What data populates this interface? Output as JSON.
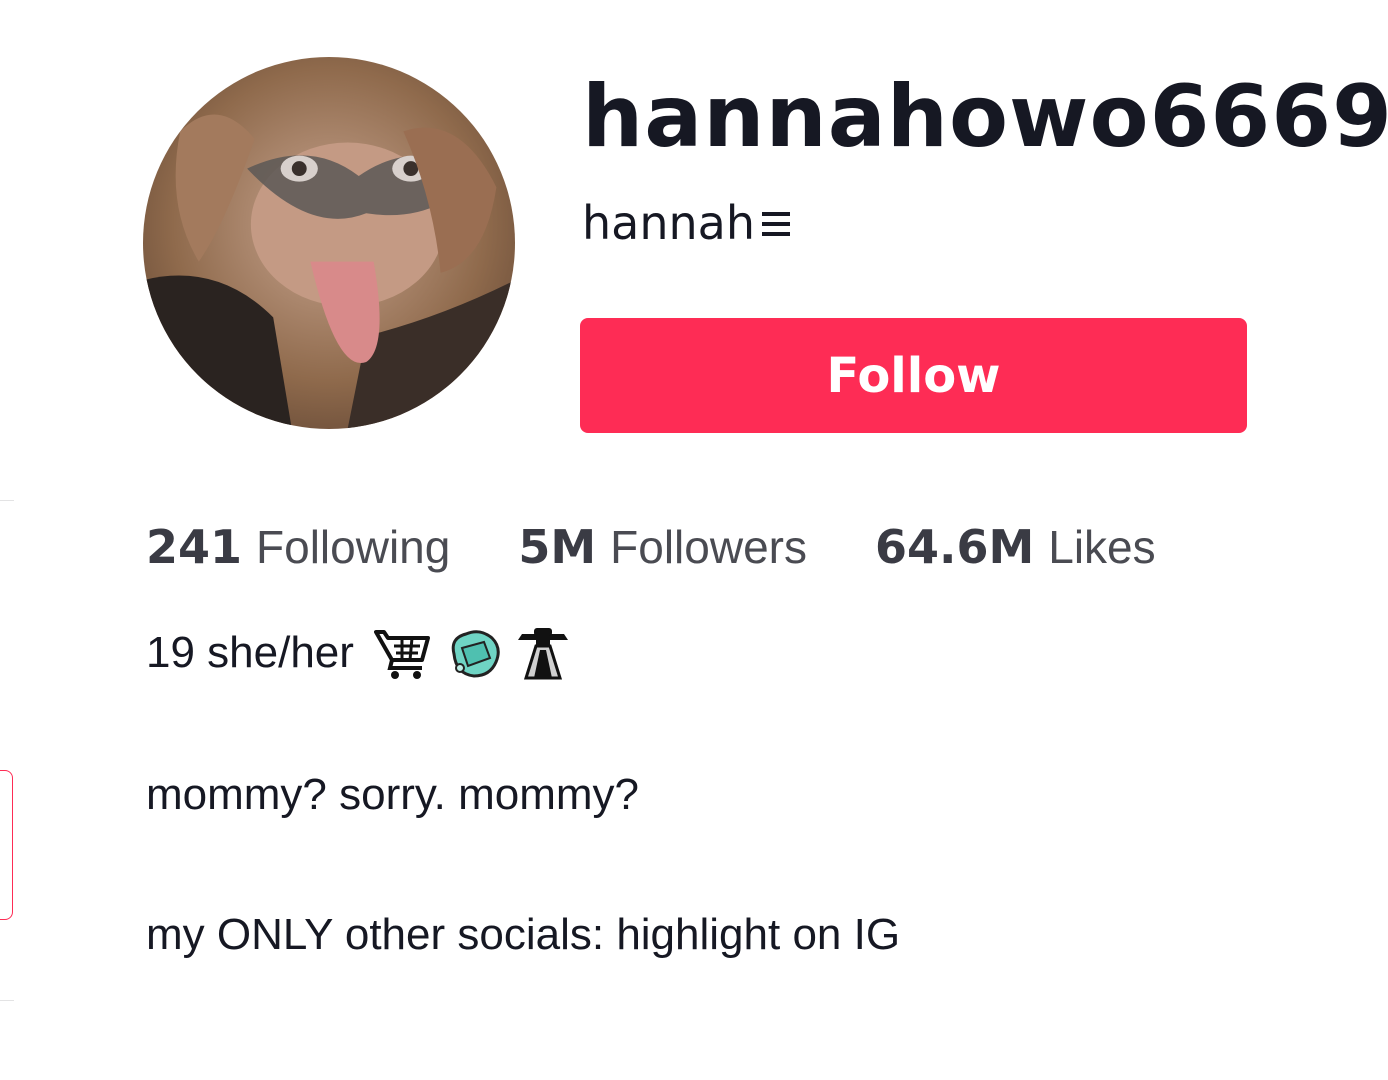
{
  "profile": {
    "username": "hannahowo6669",
    "nickname": "hannah",
    "nickname_icon": "menu-lines-icon",
    "follow_label": "Follow",
    "accent_color": "#fe2c55"
  },
  "stats": [
    {
      "value": "241",
      "label": "Following"
    },
    {
      "value": "5M",
      "label": "Followers"
    },
    {
      "value": "64.6M",
      "label": "Likes"
    }
  ],
  "bio": {
    "line1": "19 she/her",
    "line1_emojis": [
      "shopping-cart-icon",
      "soap-icon",
      "ufo-icon"
    ],
    "line2": "mommy? sorry. mommy?",
    "line3": "my ONLY other socials: highlight on IG"
  }
}
